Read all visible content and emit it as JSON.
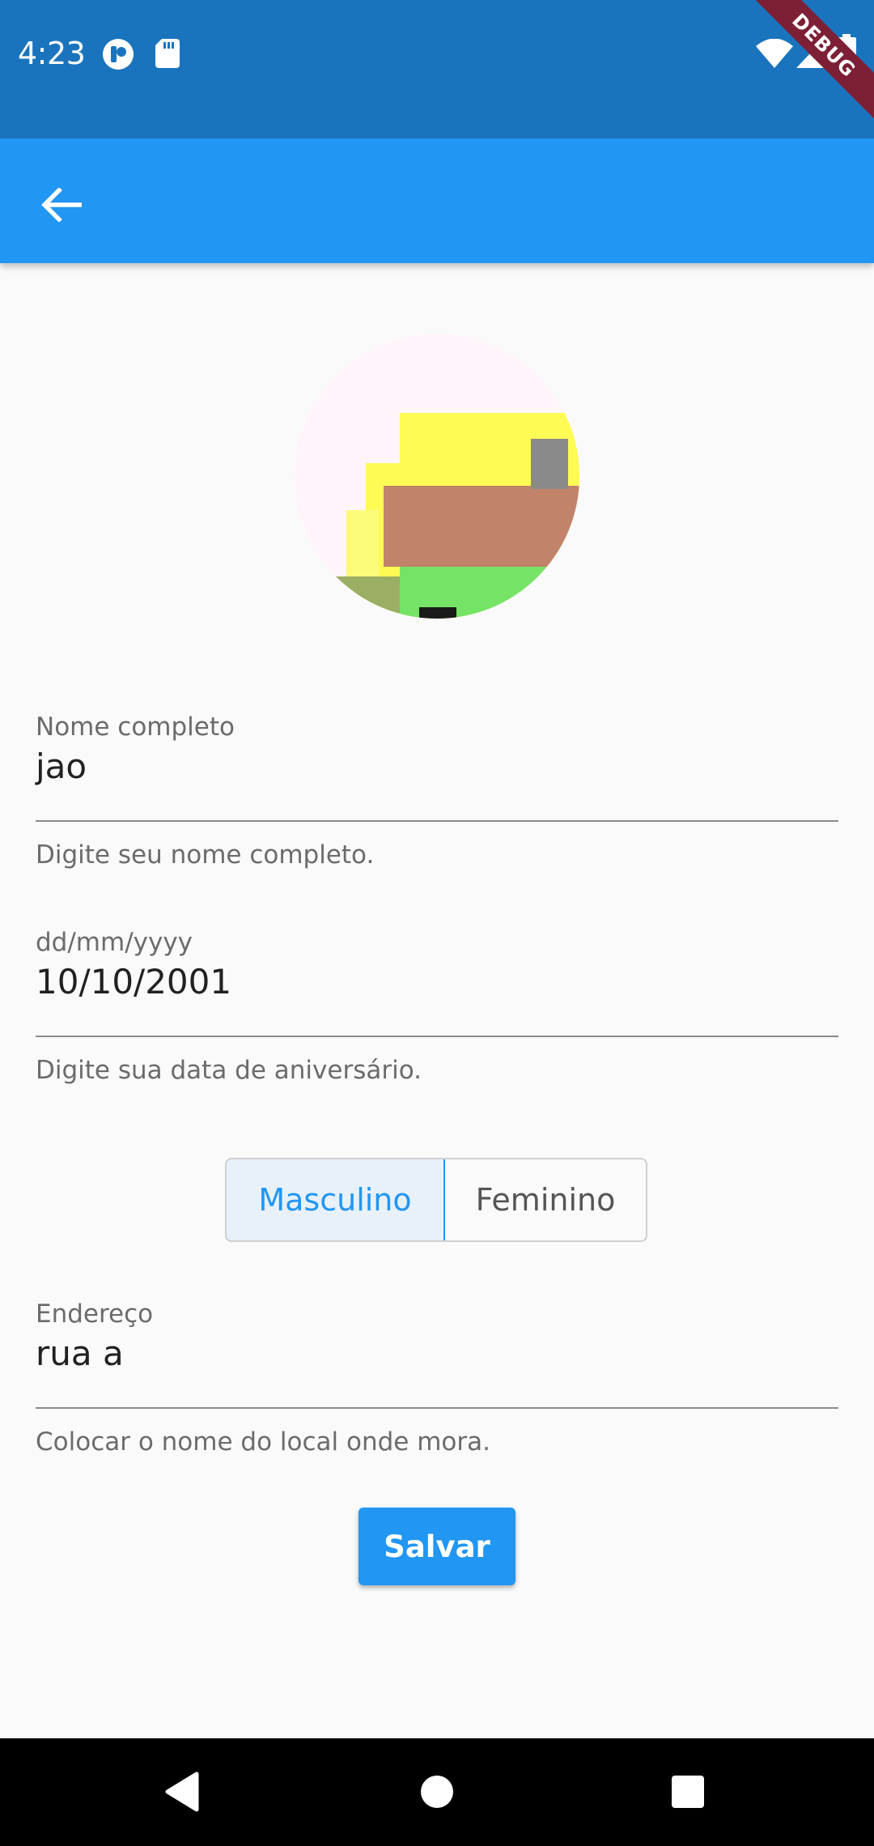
{
  "status_bar": {
    "time": "4:23",
    "icons": [
      "pocket-icon",
      "sd-card-icon",
      "wifi-icon",
      "signal-icon",
      "battery-icon"
    ],
    "debug_banner": "DEBUG",
    "colors": {
      "background": "#1a74bd",
      "banner": "#7d1f35"
    }
  },
  "app_bar": {
    "back_icon": "arrow-back-icon",
    "color": "#2196f3"
  },
  "form": {
    "name": {
      "label": "Nome completo",
      "value": "jao",
      "helper": "Digite seu nome completo."
    },
    "birthdate": {
      "label": "dd/mm/yyyy",
      "value": "10/10/2001",
      "helper": "Digite sua data de aniversário."
    },
    "gender": {
      "options": [
        "Masculino",
        "Feminino"
      ],
      "selected": "Masculino"
    },
    "address": {
      "label": "Endereço",
      "value": "rua a",
      "helper": "Colocar o nome do local onde mora."
    },
    "save_label": "Salvar"
  },
  "nav_bar": {
    "icons": [
      "back-triangle-icon",
      "home-circle-icon",
      "recents-square-icon"
    ]
  }
}
